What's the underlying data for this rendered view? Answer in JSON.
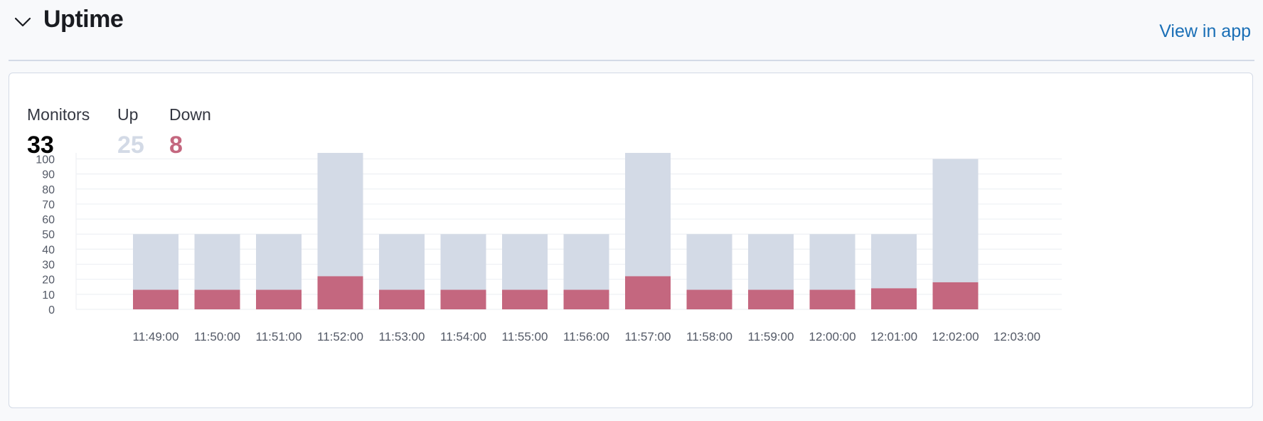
{
  "header": {
    "title": "Uptime",
    "view_link": "View in app"
  },
  "stats": {
    "monitors": {
      "label": "Monitors",
      "value": "33"
    },
    "up": {
      "label": "Up",
      "value": "25",
      "color": "#d3dae6"
    },
    "down": {
      "label": "Down",
      "value": "8",
      "color": "#c4677f"
    }
  },
  "icons": {
    "collapse": "chevron-down-icon"
  },
  "chart_data": {
    "type": "bar",
    "stacked": true,
    "categories": [
      "11:49:00",
      "11:50:00",
      "11:51:00",
      "11:52:00",
      "11:53:00",
      "11:54:00",
      "11:55:00",
      "11:56:00",
      "11:57:00",
      "11:58:00",
      "11:59:00",
      "12:00:00",
      "12:01:00",
      "12:02:00",
      "12:03:00"
    ],
    "series": [
      {
        "name": "Down",
        "color": "#c4677f",
        "values": [
          13,
          13,
          13,
          22,
          13,
          13,
          13,
          13,
          22,
          13,
          13,
          13,
          14,
          18,
          0
        ]
      },
      {
        "name": "Up",
        "color": "#d3dae6",
        "values": [
          37,
          37,
          37,
          82,
          37,
          37,
          37,
          37,
          82,
          37,
          37,
          37,
          36,
          82,
          0
        ]
      }
    ],
    "yticks": [
      0,
      10,
      20,
      30,
      40,
      50,
      60,
      70,
      80,
      90,
      100
    ],
    "ylim": [
      0,
      104
    ],
    "grid": true
  }
}
